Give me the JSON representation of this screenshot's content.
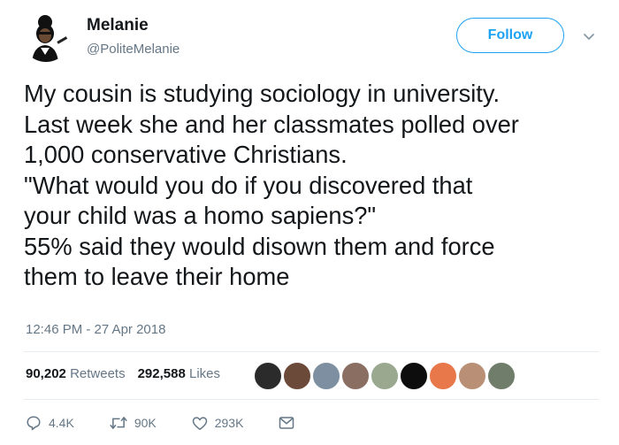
{
  "author": {
    "name": "Melanie",
    "handle": "@PoliteMelanie"
  },
  "header": {
    "follow_label": "Follow",
    "more_icon": "chevron-down-icon"
  },
  "tweet": {
    "lines": [
      "My cousin is studying sociology in university.",
      "Last week she and her classmates polled over",
      "1,000 conservative Christians.",
      "\"What would you do if you discovered that",
      "your child was a homo sapiens?\"",
      "55% said they would disown them and force",
      "them to leave their home"
    ],
    "timestamp": "12:46 PM - 27 Apr 2018"
  },
  "stats": {
    "retweets_count": "90,202",
    "retweets_label": "Retweets",
    "likes_count": "292,588",
    "likes_label": "Likes"
  },
  "liker_avatars": [
    {
      "color": "#2b2b2b"
    },
    {
      "color": "#6b4a3a"
    },
    {
      "color": "#7d8fa0"
    },
    {
      "color": "#8a6e62"
    },
    {
      "color": "#9aa890"
    },
    {
      "color": "#0d0d0d"
    },
    {
      "color": "#e8774a"
    },
    {
      "color": "#b98f76"
    },
    {
      "color": "#6f7d6a"
    }
  ],
  "actions": {
    "reply_count": "4.4K",
    "retweet_count": "90K",
    "like_count": "293K"
  },
  "colors": {
    "accent": "#1da1f2",
    "text": "#14171a",
    "muted": "#657786",
    "divider": "#e6ecf0"
  }
}
